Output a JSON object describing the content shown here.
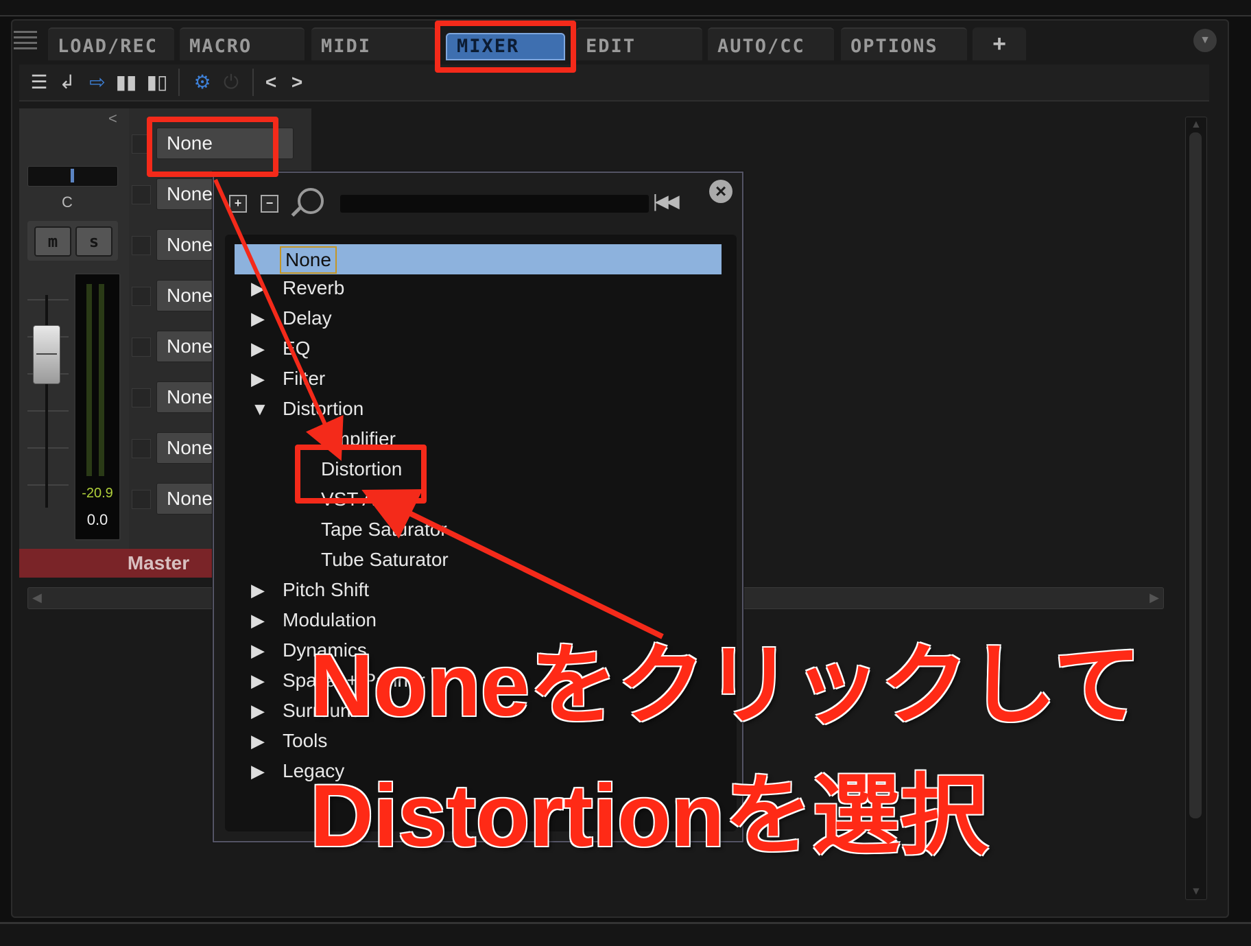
{
  "tabs": [
    {
      "label": "LOAD/REC"
    },
    {
      "label": "MACRO"
    },
    {
      "label": "MIDI"
    },
    {
      "label": "MIXER",
      "active": true
    },
    {
      "label": "EDIT"
    },
    {
      "label": "AUTO/CC"
    },
    {
      "label": "OPTIONS"
    }
  ],
  "tab_add": "+",
  "toolbar": {
    "icons": [
      "list-icon",
      "return-icon",
      "export-icon",
      "columns-icon",
      "columns-wide-icon",
      "settings-icon",
      "power-icon",
      "prev-icon",
      "next-icon"
    ],
    "prev": "<",
    "next": ">"
  },
  "channel": {
    "collapse_arrow": "<",
    "pan_label": "C",
    "mute": "m",
    "solo": "s",
    "peak": "-20.9",
    "gain": "0.0",
    "name": "Master",
    "inserts": [
      "None",
      "None",
      "None",
      "None",
      "None",
      "None",
      "None",
      "None"
    ]
  },
  "popup": {
    "expand_all": "+",
    "collapse_all": "−",
    "rewind": "|◀◀",
    "close": "×",
    "items": [
      {
        "label": "None",
        "selected": true,
        "level": 0,
        "arrow": ""
      },
      {
        "label": "Reverb",
        "level": 0,
        "arrow": "▶"
      },
      {
        "label": "Delay",
        "level": 0,
        "arrow": "▶"
      },
      {
        "label": "EQ",
        "level": 0,
        "arrow": "▶"
      },
      {
        "label": "Filter",
        "level": 0,
        "arrow": "▶"
      },
      {
        "label": "Distortion",
        "level": 0,
        "arrow": "▼"
      },
      {
        "label": "Amplifier",
        "level": 1,
        "arrow": ""
      },
      {
        "label": "Distortion",
        "level": 1,
        "arrow": ""
      },
      {
        "label": "VST Amp",
        "level": 1,
        "arrow": ""
      },
      {
        "label": "Tape Saturator",
        "level": 1,
        "arrow": ""
      },
      {
        "label": "Tube Saturator",
        "level": 1,
        "arrow": ""
      },
      {
        "label": "Pitch Shift",
        "level": 0,
        "arrow": "▶"
      },
      {
        "label": "Modulation",
        "level": 0,
        "arrow": "▶"
      },
      {
        "label": "Dynamics",
        "level": 0,
        "arrow": "▶"
      },
      {
        "label": "Spatial + Panner",
        "level": 0,
        "arrow": "▶"
      },
      {
        "label": "Surround",
        "level": 0,
        "arrow": "▶"
      },
      {
        "label": "Tools",
        "level": 0,
        "arrow": "▶"
      },
      {
        "label": "Legacy",
        "level": 0,
        "arrow": "▶"
      }
    ]
  },
  "annotation": {
    "line1": "Noneをクリックして",
    "line2": "Distortionを選択",
    "color": "#f42a1a"
  },
  "colors": {
    "active_tab": "#3e6fb0",
    "selection": "#8db2dd",
    "master": "#7a2428",
    "meter_text": "#b0d03a"
  }
}
